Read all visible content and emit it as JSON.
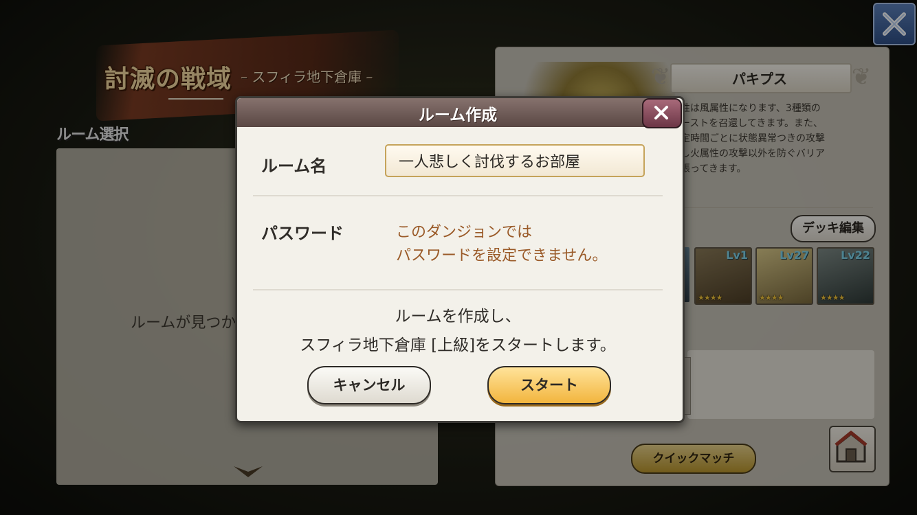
{
  "header": {
    "title": "討滅の戦域",
    "subtitle": "– スフィラ地下倉庫 –",
    "room_select_label": "ルーム選択",
    "close_icon": "close-icon"
  },
  "left_panel": {
    "message": "ルームが見つか",
    "scroll_icon": "chevron-down-icon"
  },
  "boss": {
    "name": "パキプス",
    "description": [
      "性は風属性になります、3種類の",
      "ーストを召還してきます。また、",
      "定時間ごとに状態異常つきの攻撃",
      "し火属性の攻撃以外を防ぐバリア",
      "張ってきます。"
    ]
  },
  "deck": {
    "edit_label": "デッキ編集",
    "cards": [
      {
        "level": "Lv1",
        "stars": "★★★★"
      },
      {
        "level": "Lv27",
        "stars": "★★★★"
      },
      {
        "level": "Lv22",
        "stars": "★★★★"
      }
    ]
  },
  "quick_match_label": "クイックマッチ",
  "modal": {
    "title": "ルーム作成",
    "room_name_label": "ルーム名",
    "room_name_value": "一人悲しく討伐するお部屋",
    "password_label": "パスワード",
    "password_note_line1": "このダンジョンでは",
    "password_note_line2": "パスワードを設定できません。",
    "confirm_line1": "ルームを作成し、",
    "confirm_line2": "スフィラ地下倉庫 [上級]をスタートします。",
    "cancel_label": "キャンセル",
    "start_label": "スタート"
  },
  "colors": {
    "accent_gold": "#f2b53e",
    "note_brown": "#9a5a28",
    "modal_header": "#6e5a55",
    "close_blue": "#3f62a0"
  }
}
